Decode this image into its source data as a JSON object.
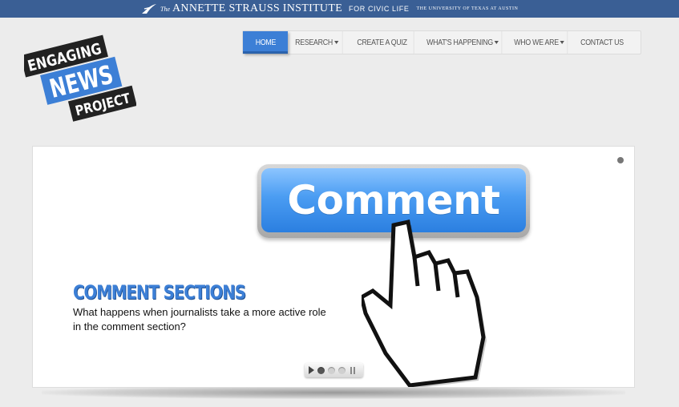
{
  "institute_bar": {
    "the": "The",
    "name": "ANNETTE STRAUSS INSTITUTE",
    "civic": "FOR CIVIC LIFE",
    "university": "THE UNIVERSITY OF TEXAS AT AUSTIN"
  },
  "logo": {
    "line1": "ENGAGING",
    "line2": "NEWS",
    "line3": "PROJECT"
  },
  "nav": {
    "items": [
      {
        "label": "HOME",
        "active": true,
        "dropdown": false
      },
      {
        "label": "RESEARCH",
        "active": false,
        "dropdown": true
      },
      {
        "label": "CREATE A QUIZ",
        "active": false,
        "dropdown": false
      },
      {
        "label": "WHAT'S HAPPENING",
        "active": false,
        "dropdown": true
      },
      {
        "label": "WHO WE ARE",
        "active": false,
        "dropdown": true
      },
      {
        "label": "CONTACT US",
        "active": false,
        "dropdown": false
      }
    ]
  },
  "slide": {
    "button_text": "Comment",
    "title": "COMMENT SECTIONS",
    "description": "What happens when journalists take a more active role in the comment section?"
  },
  "slider_controls": {
    "dot_count": 3,
    "active_dot": 0
  },
  "colors": {
    "accent": "#3c7fd6",
    "topbar": "#3a5f95",
    "logo_dark": "#222222"
  }
}
